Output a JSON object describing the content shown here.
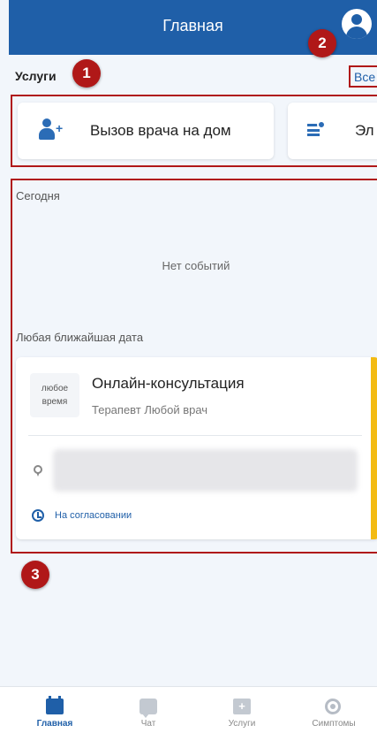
{
  "header": {
    "title": "Главная",
    "avatar_icon": "user-avatar-icon"
  },
  "markers": [
    "1",
    "2",
    "3"
  ],
  "services": {
    "label": "Услуги",
    "all_link": "Все",
    "items": [
      {
        "label": "Вызов врача на дом",
        "icon": "doctor-home-icon"
      },
      {
        "label": "Эл",
        "icon": "medical-card-icon"
      }
    ]
  },
  "events": {
    "today_label": "Сегодня",
    "no_events": "Нет событий",
    "nearest_label": "Любая ближайшая дата",
    "card": {
      "time_line1": "любое",
      "time_line2": "время",
      "title": "Онлайн-консультация",
      "subtitle": "Терапевт Любой врач",
      "status": "На согласовании",
      "accent_color": "#f3bb13"
    }
  },
  "bottom_nav": [
    {
      "label": "Главная",
      "icon": "calendar-icon",
      "active": true
    },
    {
      "label": "Чат",
      "icon": "chat-icon",
      "active": false
    },
    {
      "label": "Услуги",
      "icon": "medical-bag-icon",
      "active": false
    },
    {
      "label": "Симптомы",
      "icon": "virus-icon",
      "active": false
    }
  ],
  "colors": {
    "primary": "#1f5fa8",
    "marker": "#b01818",
    "background": "#f2f6fb"
  }
}
